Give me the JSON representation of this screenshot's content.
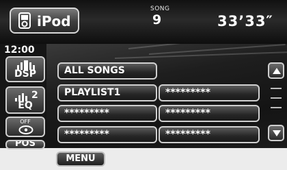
{
  "header": {
    "source_label": "iPod",
    "source_icon": "ipod-icon",
    "song_caption": "SONG",
    "song_number": "9",
    "elapsed_time": "33’33″"
  },
  "sidebar": {
    "clock": "12:00",
    "dsp_label": "DSP",
    "eq_label": "EQ",
    "eq_preset": "2",
    "sound_status": "OFF",
    "pos_label": "POS"
  },
  "list": {
    "column1": [
      "ALL SONGS",
      "PLAYLIST1",
      "*********",
      "*********"
    ],
    "column2": [
      "*********",
      "*********",
      "*********"
    ]
  },
  "scroll": {
    "up_icon": "triangle-up-icon",
    "down_icon": "triangle-down-icon"
  },
  "footer": {
    "menu_label": "MENU"
  },
  "colors": {
    "background": "#ececec",
    "panel": "#151515",
    "button_border": "#d0d0d0",
    "text": "#ffffff"
  }
}
